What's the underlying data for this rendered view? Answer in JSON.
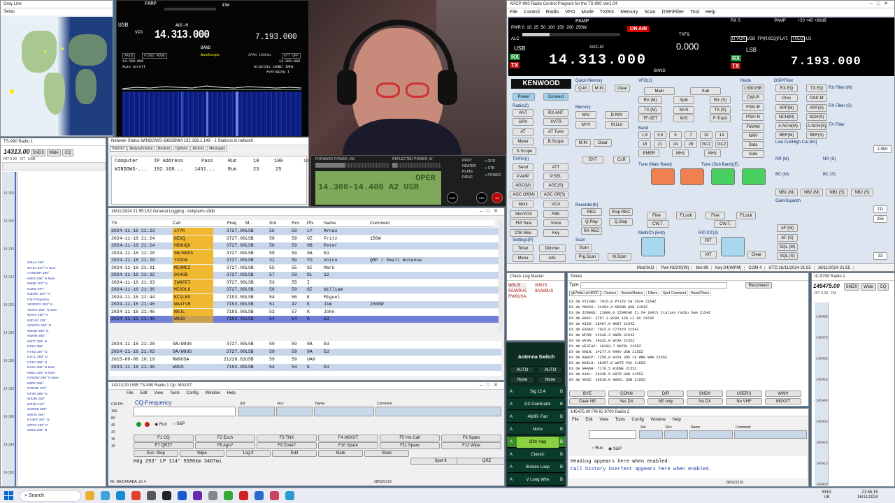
{
  "grayline": {
    "title": "Gray Line",
    "menu": "Setup"
  },
  "sdr": {
    "title": "TS-990 Radio 1",
    "freq": "14313.00",
    "tabs": [
      "SNDX",
      "Wide",
      "CQ"
    ],
    "info": [
      "RIT",
      "0.00",
      "XIT",
      "USB"
    ],
    "marks": [
      "14.300",
      "14.305",
      "14.310",
      "14.315",
      "14.320",
      "14.325",
      "14.330",
      "14.335",
      "14.340",
      "14.345",
      "14.350"
    ],
    "spots": [
      "W6AA 296°",
      "WY3A 287° N New",
      "AA8WUR 190°",
      "K6KX 296° N New",
      "N5QE 287° N",
      "K4ZW 287°",
      "N3DRK 287° N",
      "CQ-Frequency",
      "VE3RGG 292° N",
      "VE3VT 292° N New",
      "W1KX 288° N",
      "K8CAG 125°",
      "VE3IGG 292° N",
      "W5QD 285° N",
      "NW0M 286°",
      "K8CT 296° N",
      "KE5A 296°",
      "KT4Q 287° N",
      "K2CC 286° N",
      "KT4V 286° N",
      "KK6V 286° N New",
      "KB5U 286° N New",
      "N7MZW 296° N New",
      "KB0K 296°",
      "NTMZE 310°",
      "NF3R 288° N",
      "W4ZM 289°",
      "WT4N 310°",
      "W4EEE 289°",
      "W8NX 294°",
      "KY4KP 287° N",
      "WP2V 292° N",
      "KB8S 286° N"
    ]
  },
  "screen_radio": {
    "pamp": "PAMP",
    "watts": "43W",
    "mode": "USB",
    "vfo": "VFO",
    "freq_main": "14.313.000",
    "freq_sub": "7.193.000",
    "agc": "AGC-M",
    "band": "BAND",
    "tabs": [
      "MAIN",
      "FIXED MODE",
      "Bandscope",
      "SPAN 100kHz",
      "ATT OFF"
    ],
    "scale_l": "14.260.000",
    "scale_r": "14.360.000",
    "auto_scroll": "Auto Scroll",
    "averaging": "Averaging 1",
    "grid": "Grid/div 10dB/ 1MHz"
  },
  "netstatus": {
    "title": "Network Status WINDOWS-8392BMM 192.168.1.149 - 1 Stations in network",
    "tabs": [
      "Stations",
      "Resynchronize",
      "Restore",
      "Options",
      "Actions",
      "Messages"
    ],
    "headers": [
      "Computer",
      "IP Address",
      "Pass",
      "Run",
      "10",
      "100"
    ],
    "row": [
      "WINDOWS-...",
      "192.168...",
      "1431...",
      "Run",
      "23",
      "25"
    ],
    "extra": "14"
  },
  "meter": {
    "fwd": "FORWARD POWER, kW",
    "refl": "REFLECTED POWER, W",
    "lcd_top": "OPER",
    "lcd_bottom": "14.300-14.400 A2 USR",
    "labels": [
      "PROT",
      "HEATER",
      "PLATE",
      "DRIVE"
    ],
    "status": [
      "OPR",
      "STB",
      "POWER"
    ],
    "buttons": [
      "CHD",
      "OPR STB",
      "ON OFF"
    ]
  },
  "genlog": {
    "title": "16/11/2024 21:55:152 General Logging - hollyfarm.s3db",
    "headers": [
      "TS",
      "Call",
      "Freq",
      "M...",
      "Snt",
      "Rcv",
      "Pfx",
      "Name",
      "Comment"
    ],
    "rows": [
      [
        "2024-11-16 21:23",
        "LY7K",
        "3727.00",
        "LSB",
        "56",
        "58",
        "LY",
        "Arnas",
        ""
      ],
      [
        "2024-11-16 21:24",
        "OZ2Q",
        "3727.00",
        "LSB",
        "58",
        "59",
        "OZ",
        "Fritz",
        "150W"
      ],
      [
        "2024-11-16 21:24",
        "HB9UQX",
        "3727.00",
        "LSB",
        "56",
        "59",
        "HB",
        "Peter",
        ""
      ],
      [
        "2024-11-16 21:28",
        "9A/W9US",
        "3727.00",
        "LSB",
        "59",
        "59",
        "9A",
        "Ed",
        ""
      ],
      [
        "2024-11-16 21:29",
        "YO2DA",
        "3727.00",
        "LSB",
        "31",
        "59",
        "YO",
        "Voicu",
        "QRP / Small Antenna"
      ],
      [
        "2024-11-16 21:31",
        "MI0MCZ",
        "3727.00",
        "LSB",
        "55",
        "55",
        "GI",
        "Mark",
        ""
      ],
      [
        "2024-11-16 21:32",
        "DO4GB",
        "3727.00",
        "LSB",
        "57",
        "59",
        "DL",
        "12",
        ""
      ],
      [
        "2024-11-16 21:33",
        "IW9FFI",
        "3727.00",
        "LSB",
        "53",
        "55",
        "I",
        "",
        ""
      ],
      [
        "2024-11-16 21:36",
        "MI0DLG",
        "3727.00",
        "LSB",
        "56",
        "58",
        "GI",
        "William",
        ""
      ],
      [
        "2024-11-16 21:44",
        "KC1LKO",
        "7193.00",
        "LSB",
        "54",
        "56",
        "K",
        "Miguel",
        ""
      ],
      [
        "2024-11-16 21:46",
        "WA4TVN",
        "7193.00",
        "LSB",
        "51",
        "47",
        "K",
        "Jim",
        "1500W"
      ],
      [
        "2024-11-16 21:46",
        "N0JL",
        "7193.00",
        "LSB",
        "52",
        "57",
        "K",
        "John",
        ""
      ],
      [
        "2024-11-16 21:48",
        "W9US",
        "7193.00",
        "LSB",
        "54",
        "54",
        "K",
        "Ed",
        ""
      ]
    ],
    "dupes": [
      [
        "2024-11-16 21:28",
        "9A/W9US",
        "3727.00",
        "LSB",
        "59",
        "59",
        "9A",
        "Ed"
      ],
      [
        "2024-11-16 21:02",
        "9A/W9US",
        "3727.00",
        "LSB",
        "59",
        "59",
        "9A",
        "Ed"
      ],
      [
        "2015-09-06 10:19",
        "RW9USA",
        "21228.62",
        "USB",
        "59",
        "59",
        "UA9",
        ""
      ],
      [
        "2024-11-16 21:48",
        "W9US",
        "7193.00",
        "LSB",
        "54",
        "54",
        "K",
        "Ed"
      ]
    ]
  },
  "radio1": {
    "title": "14313.00 USB TS-990 Radio 1    Op: M0XXT",
    "menu": [
      "File",
      "Edit",
      "View",
      "Tools",
      "Config",
      "Window",
      "Help"
    ],
    "cq": "CQ-Frequency",
    "col_labels": [
      "Snt",
      "Rcv",
      "Name",
      "Comment"
    ],
    "left_labels": [
      "CW",
      "PH",
      "160",
      "80",
      "40",
      "20",
      "15",
      "10"
    ],
    "run": "Run",
    "sp": "S&P",
    "fkeys": [
      "F1 CQ",
      "F2 Exch",
      "F3 TNX",
      "F4 M0XXT",
      "F5 His Call",
      "F6 Spare",
      "F7 QRZ?",
      "F8 Agn?",
      "F9 Zone?",
      "F10 Spare",
      "F11 Spare",
      "F12 Wipe",
      "Esc: Stop",
      "Wipe",
      "Log It",
      "Edit",
      "Mark",
      "Store",
      "Spot It",
      "QRZ"
    ],
    "hdg": "Hdg 293° LP 114° 5580km 3467mi",
    "status_l": "VE: NA/CANADA, Zn 4",
    "status_r": "28/53/1216"
  },
  "arcp": {
    "title": "ARCP-990 Radio Control Program for the TS-990 Ver1.04",
    "menu": [
      "File",
      "Control",
      "Radio",
      "VFO",
      "Mode",
      "TX/RX",
      "Memory",
      "Scan",
      "DSP/Filter",
      "Tool",
      "Help"
    ],
    "pamp": "PAMP",
    "on_air": "ON AIR",
    "pwr_scale": [
      "PWR",
      "0",
      "10",
      "25",
      "50",
      "100",
      "150",
      "200",
      "250W"
    ],
    "alc": "ALC",
    "txfil": "TXFIL",
    "offset": "0.000",
    "main_mode": "USB",
    "agc": "AGC-M",
    "main_freq": "14.313.000",
    "sub_mode": "LSB",
    "sub_freq": "7.193.000",
    "sub_tags": [
      "D.VOX",
      "USB",
      "FP",
      "RXEQ",
      "FLAT.",
      "TXEQ",
      "U2"
    ],
    "sub_scale": [
      "RX",
      "S",
      "PAMP",
      "+20",
      "+40",
      "+60dB"
    ],
    "band": "BAND",
    "brand": "KENWOOD",
    "power": "Power",
    "connect": "Connect",
    "sections": [
      "Quick Memory",
      "Memory",
      "VFO(1)",
      "Mode",
      "DSP/Filter",
      "Radio(2)",
      "Band",
      "TX/RX(I)",
      "Recorder(K)",
      "Tune (Main Band)",
      "Tune (Sub Band)(E)",
      "Settings(P)",
      "Scan",
      "Multi/Ch (kHz)",
      "RIT/XIT(3)",
      "Low Cut/High Cut [Hz]",
      "Gain/Squelch",
      "NR (M)",
      "NR (S)",
      "BC (M)",
      "BC (S)",
      "RX Filter (M)",
      "RX Filter (S)",
      "TX Filter"
    ],
    "status": [
      "Mod:M.D",
      "Pwr:43/200(W)",
      "Mic:99",
      "Key:24(WPM)",
      "COM 4",
      "UTC:16/11/2024 21:55",
      "16/11/2024 21:55"
    ],
    "hicut": "2,900",
    "rf_vals": [
      "211",
      "255",
      "33"
    ]
  },
  "checklog": {
    "title": "Check Log Master",
    "calls": [
      "W9US",
      "9A/W9US",
      "RW9USA"
    ]
  },
  "antenna": {
    "title": "Antenna Switch",
    "modes": [
      "AUTO",
      "AUTO",
      "None",
      "None"
    ],
    "rows": [
      "Sig 12.4",
      "DX Dominator",
      "40/80- Fan",
      "None",
      "20m Yagi",
      "Classic",
      "Broken Loop",
      "V Long Wire"
    ]
  },
  "telnet": {
    "title": "Telnet",
    "type_label": "Type:",
    "reconnect": "Reconnect",
    "tabs": [
      "gb7mbc.net:8000",
      "Clusters",
      "Bands/Modes",
      "Filters",
      "Spot Comment",
      "Band/Plans"
    ],
    "lines": [
      "DX de PY1SAD:   7015.0  PY1ZV         CW  2024              2154Z",
      "DX de M0XXX:   14254.4  KD2ND         USB                    2154Z",
      "DX de IZ0EKE:  21800.0  IZ0MCAD      21.54 100th Italian radio ham 2154Z",
      "DX de R8XF:     3767.3  BC9X         120 LZ DX              2154Z",
      "DX de KI2D:    28467.0  NK8T                                 2154Z",
      "DX de EA5KX:    7023.0  C77XYO                               2154Z",
      "DX de NF3R:    14318.3  K8ZN                                 2154Z",
      "DX de WY3A:    14332.0  WY3A                                 2155Z",
      "DX de VE3TAC:  18103.7  NN7RL                                2155Z",
      "DX de NN1N:    14277.9  KH0V          USB                    2155Z",
      "DX de KB0CP:    7250.0  W1YK          385 16 WMA WMA         2155Z",
      "DX de KK5LO:   28407.8  WH7Z          PAC                    2155Z",
      "DX de N4ADA:    7176.5  K1DNE                                2155Z",
      "DX de K4XL:    28338.5  K8TR          USB                    2155Z",
      "DX de NX3Z:    28519.0  N6ACL         USB                    2155Z"
    ],
    "btns1": [
      "BYE",
      "CONN",
      "DIR",
      "SNDX",
      "USERS",
      "WWV"
    ],
    "btns2": [
      "Clear NE",
      "Yes DX",
      "NE only",
      "No DX",
      "No VHF",
      "M0XXT"
    ]
  },
  "radio2sdr": {
    "title": "IC-9700 Radio 2",
    "freq": "145475.00",
    "tabs": [
      "SNDX",
      "Wide",
      "CQ"
    ],
    "info": [
      "RIT",
      "0.00",
      "FM"
    ],
    "marks": [
      "145480",
      "145470",
      "145460",
      "145450",
      "145440",
      "145430",
      "145420",
      "145410",
      "145400"
    ]
  },
  "radio2": {
    "title": "145475.00 FM IC-9700 Radio 2",
    "menu": [
      "File",
      "Edit",
      "View",
      "Tools",
      "Config",
      "Window",
      "Help"
    ],
    "cols": [
      "Snt",
      "Rcv",
      "Name",
      "Comment"
    ],
    "run": "Run",
    "sp": "S&P",
    "info1": "Heading appears here when enabled.",
    "info2": "Call history UserText appears here when enabled.",
    "status_r": "28/53/1216"
  },
  "taskbar": {
    "search": "Search",
    "lang": "ENG",
    "region": "UK",
    "time": "21:55:15",
    "date": "16/11/2024"
  }
}
